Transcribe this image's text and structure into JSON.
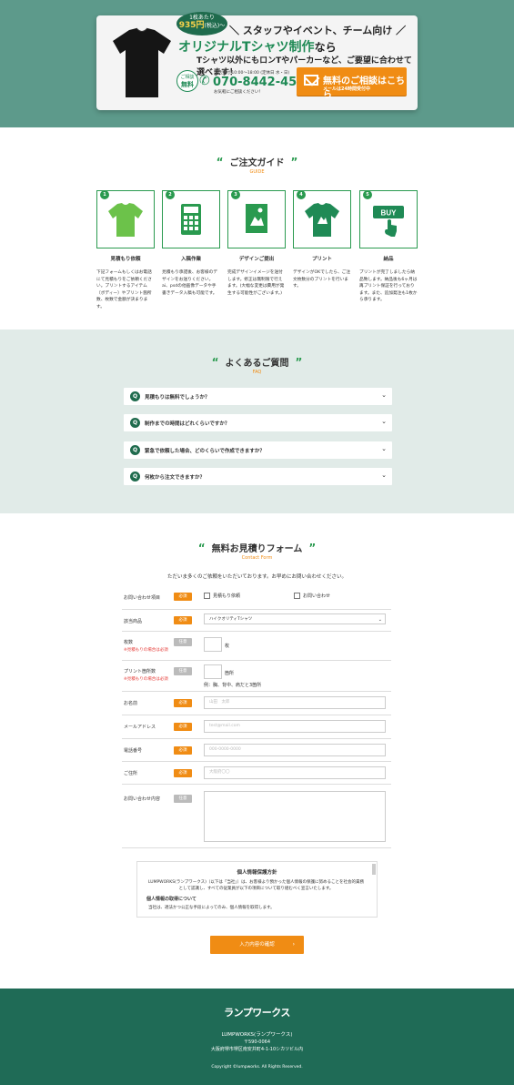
{
  "hero": {
    "price_top": "1枚あたり",
    "price_value": "935円",
    "price_suffix": "(税込)～",
    "tagline": "＼ スタッフやイベント、チーム向け ／",
    "headline_main": "オリジナルTシャツ制作",
    "headline_suffix": "なら",
    "subline": "Tシャツ以外にもロンTやパーカーなど、ご要望に合わせて選べます！",
    "consult_top": "ご相談",
    "consult_bottom": "無料",
    "hours": "電話受付 10:00～18:00 (定休日 水・日)",
    "phone": "070-8442-4547",
    "phone_note": "お気軽にご相談ください！",
    "cta_title": "無料のご相談はこちら",
    "cta_sub": "メールは24時間受付中",
    "colors": {
      "green": "#1f8a55",
      "orange": "#f08c14",
      "bg": "#5d9a8b"
    }
  },
  "guide": {
    "title": "ご注文ガイド",
    "title_en": "GUIDE",
    "steps": [
      {
        "num": "1",
        "title": "見積もり依頼",
        "desc": "下記フォームもしくはお電話にて見積もりをご依頼ください。プリントするアイテム（ボディー）やプリント箇所数、枚数で金額が決まります。",
        "icon": "green-tshirt-icon"
      },
      {
        "num": "2",
        "title": "入稿作業",
        "desc": "見積もり承諾後、お客様のデザインをお送りください。ai、psdの他画像データや手書きデータ入稿も可能です。",
        "icon": "calculator-icon"
      },
      {
        "num": "3",
        "title": "デザインご提出",
        "desc": "完成デザインイメージを送付します。修正は無制限で行えます。(大幅な変更は費用が発生する可能性がございます。)",
        "icon": "design-image-icon"
      },
      {
        "num": "4",
        "title": "プリント",
        "desc": "デザインがOKでしたら、ご注文枚数分のプリントを行います。",
        "icon": "printed-tshirt-icon"
      },
      {
        "num": "5",
        "title": "納品",
        "desc": "プリントが完了しましたら納品致します。納品後も6ヶ月は再プリント保証を行っております。また、追加発注も1枚から承ります。",
        "icon": "buy-button-icon"
      }
    ]
  },
  "faq": {
    "title": "よくあるご質問",
    "title_en": "FAQ",
    "q_mark": "Q",
    "items": [
      "見積もりは無料でしょうか？",
      "制作までの時間はどれくらいですか？",
      "緊急で依頼した場合、どのくらいで作成できますか？",
      "何枚から注文できますか？"
    ]
  },
  "form": {
    "title": "無料お見積りフォーム",
    "title_en": "Contact Form",
    "intro": "ただいま多くのご依頼をいただいております。お早めにお問い合わせください。",
    "required": "必須",
    "optional": "任意",
    "fields": {
      "inquiry_type": {
        "label": "お問い合わせ項目",
        "options": [
          "見積もり依頼",
          "お問い合わせ"
        ]
      },
      "product": {
        "label": "該当商品",
        "value": "ハイクオリティTシャツ"
      },
      "quantity": {
        "label": "枚数",
        "note": "※見積もりの場合は必須",
        "unit": "枚"
      },
      "print_spots": {
        "label": "プリント箇所数",
        "note": "※見積もりの場合は必須",
        "unit": "箇所",
        "example": "例：胸、背中、肩だと3箇所"
      },
      "name": {
        "label": "お名前",
        "placeholder": "山田　太郎"
      },
      "email": {
        "label": "メールアドレス",
        "placeholder": "test@mail.com"
      },
      "tel": {
        "label": "電話番号",
        "placeholder": "000-0000-0000"
      },
      "address": {
        "label": "ご住所",
        "placeholder": "大阪府〇〇"
      },
      "message": {
        "label": "お問い合わせ内容"
      }
    },
    "privacy": {
      "title": "個人情報保護方針",
      "body": "LUMPWORKS(ランプワークス)（以下は「当社」）は、お客様より預かった個人情報の保護に努めることを社会的責務として認識し、すべての従業員が以下の項目について取り組むべく宣言いたします。",
      "sub": "個人情報の取得について",
      "sub_body": "当社は、適法かつ公正な手段によってのみ、個人情報を取得します。"
    },
    "submit": "入力内容の確認",
    "submit_arrow": "›"
  },
  "footer": {
    "logo": "ランプワークス",
    "name": "LUMPWORKS(ランプワークス)",
    "zip": "〒590-0064",
    "address": "大阪府堺市堺区南安井町4-1-10シカツビル内",
    "copyright": "Copyright ©lumpworks. All Rights Reserved."
  }
}
